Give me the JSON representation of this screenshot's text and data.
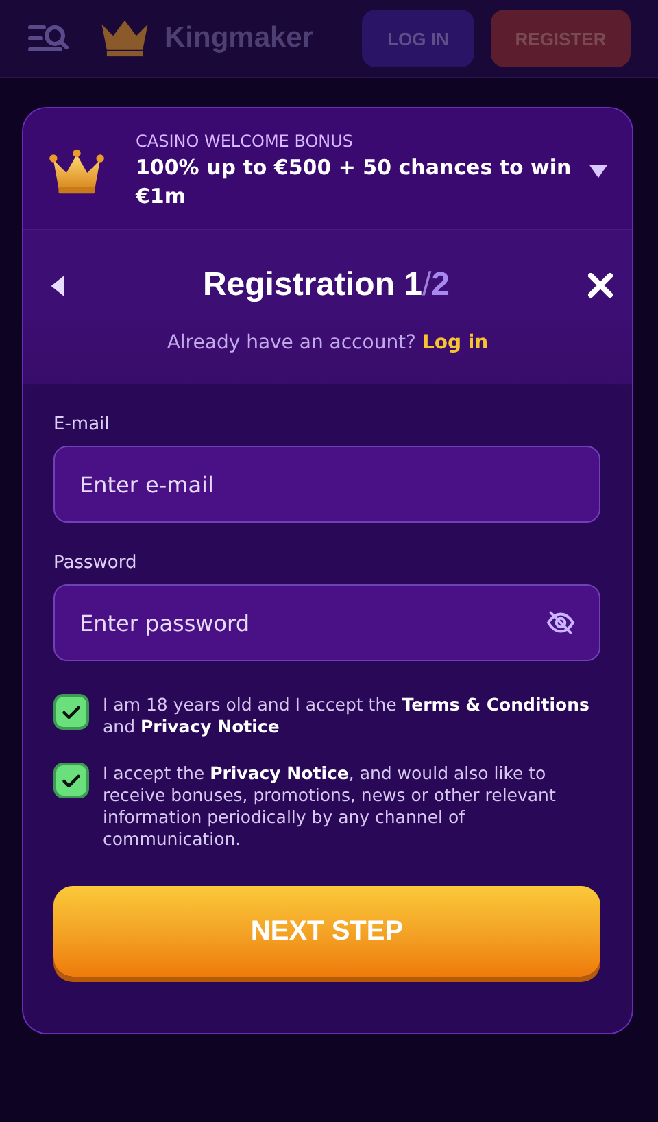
{
  "header": {
    "brand": "Kingmaker",
    "login": "LOG IN",
    "register": "REGISTER"
  },
  "bonus": {
    "label": "CASINO WELCOME BONUS",
    "text": "100% up to €500 + 50 chances to win €1m",
    "expanded": false
  },
  "dialog": {
    "title": "Registration 1",
    "separator": "/",
    "total": "2",
    "prompt": "Already have an account?",
    "login_link": "Log in"
  },
  "fields": [
    {
      "label": "E-mail",
      "placeholder": "Enter e-mail",
      "kind": "email"
    },
    {
      "label": "Password",
      "placeholder": "Enter password",
      "kind": "password"
    }
  ],
  "consents": [
    {
      "text": "I am 18 years old and I accept the **Terms & Conditions** and **Privacy Notice**",
      "checked": true
    },
    {
      "text": "I accept the **Privacy Notice**, and would also like to receive bonuses, promotions, news or other relevant information periodically by any channel of communication.",
      "checked": true
    }
  ],
  "submit": "NEXT STEP"
}
